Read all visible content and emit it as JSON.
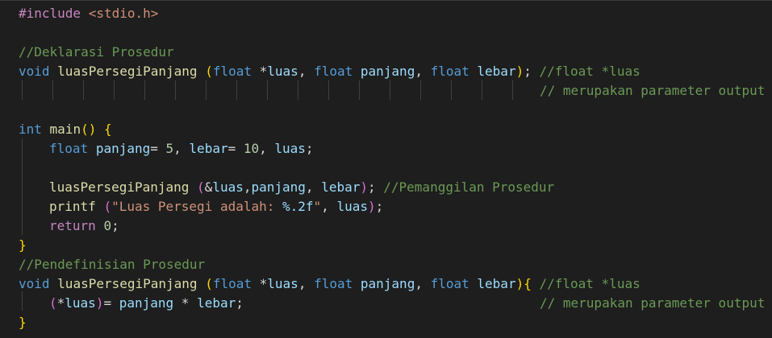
{
  "code": {
    "include_directive": "#include",
    "include_header": "<stdio.h>",
    "comment_declaration": "//Deklarasi Prosedur",
    "kw_void": "void",
    "kw_float": "float",
    "kw_int": "int",
    "kw_return": "return",
    "fn_name": "luasPersegiPanjang",
    "fn_main": "main",
    "fn_printf": "printf",
    "param_luas": "luas",
    "param_panjang": "panjang",
    "param_lebar": "lebar",
    "comment_float_luas": "//float *luas",
    "comment_param_output": "// merupakan parameter output",
    "num_5": "5",
    "num_10": "10",
    "num_0": "0",
    "comment_call": "//Pemanggilan Prosedur",
    "string_part1": "\"Luas Persegi adalah: ",
    "string_format": "%.2f",
    "string_part2": "\"",
    "comment_definition": "//Pendefinisian Prosedur"
  }
}
